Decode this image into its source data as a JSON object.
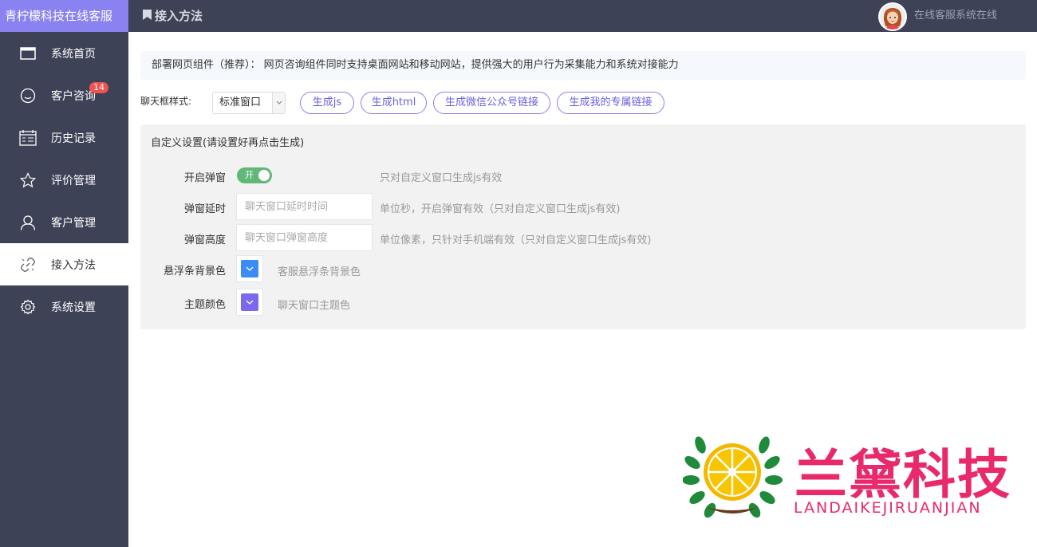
{
  "sidebar": {
    "brand": "青柠檬科技在线客服",
    "items": [
      {
        "label": "系统首页",
        "icon": "window-icon"
      },
      {
        "label": "客户咨询",
        "icon": "smile-icon",
        "badge": "14"
      },
      {
        "label": "历史记录",
        "icon": "calendar-icon"
      },
      {
        "label": "评价管理",
        "icon": "star-icon"
      },
      {
        "label": "客户管理",
        "icon": "user-icon"
      },
      {
        "label": "接入方法",
        "icon": "link-icon",
        "active": true
      },
      {
        "label": "系统设置",
        "icon": "gear-icon"
      }
    ]
  },
  "header": {
    "title": "接入方法",
    "status": "在线客服系统在线"
  },
  "main": {
    "tip": "部署网页组件（推荐）：  网页咨询组件同时支持桌面网站和移动网站，提供强大的用户行为采集能力和系统对接能力",
    "style_label": "聊天框样式:",
    "style_select": "标准窗口",
    "buttons": [
      "生成js",
      "生成html",
      "生成微信公众号链接",
      "生成我的专属链接"
    ],
    "panel": {
      "title": "自定义设置(请设置好再点击生成)",
      "popup_label": "开启弹窗",
      "popup_toggle": "开",
      "popup_hint": "只对自定义窗口生成js有效",
      "delay_label": "弹窗延时",
      "delay_placeholder": "聊天窗口延时时间",
      "delay_hint": "单位秒，开启弹窗有效（只对自定义窗口生成js有效)",
      "height_label": "弹窗高度",
      "height_placeholder": "聊天窗口弹窗高度",
      "height_hint": "单位像素，只针对手机端有效（只对自定义窗口生成js有效)",
      "bar_color_label": "悬浮条背景色",
      "bar_color_hint": "客服悬浮条背景色",
      "bar_color": "#3b8cf5",
      "theme_color_label": "主题颜色",
      "theme_color_hint": "聊天窗口主题色",
      "theme_color": "#7b68ee"
    }
  },
  "watermark": {
    "text": "兰黛科技",
    "subtext": "LANDAIKEJIRUANJIAN"
  },
  "colors": {
    "sidebar": "#3d4256",
    "brand": "#8a82f0",
    "accent": "#6a62e0",
    "toggle_on": "#5fb878",
    "badge": "#f0524f",
    "watermark": "#e8296b"
  }
}
